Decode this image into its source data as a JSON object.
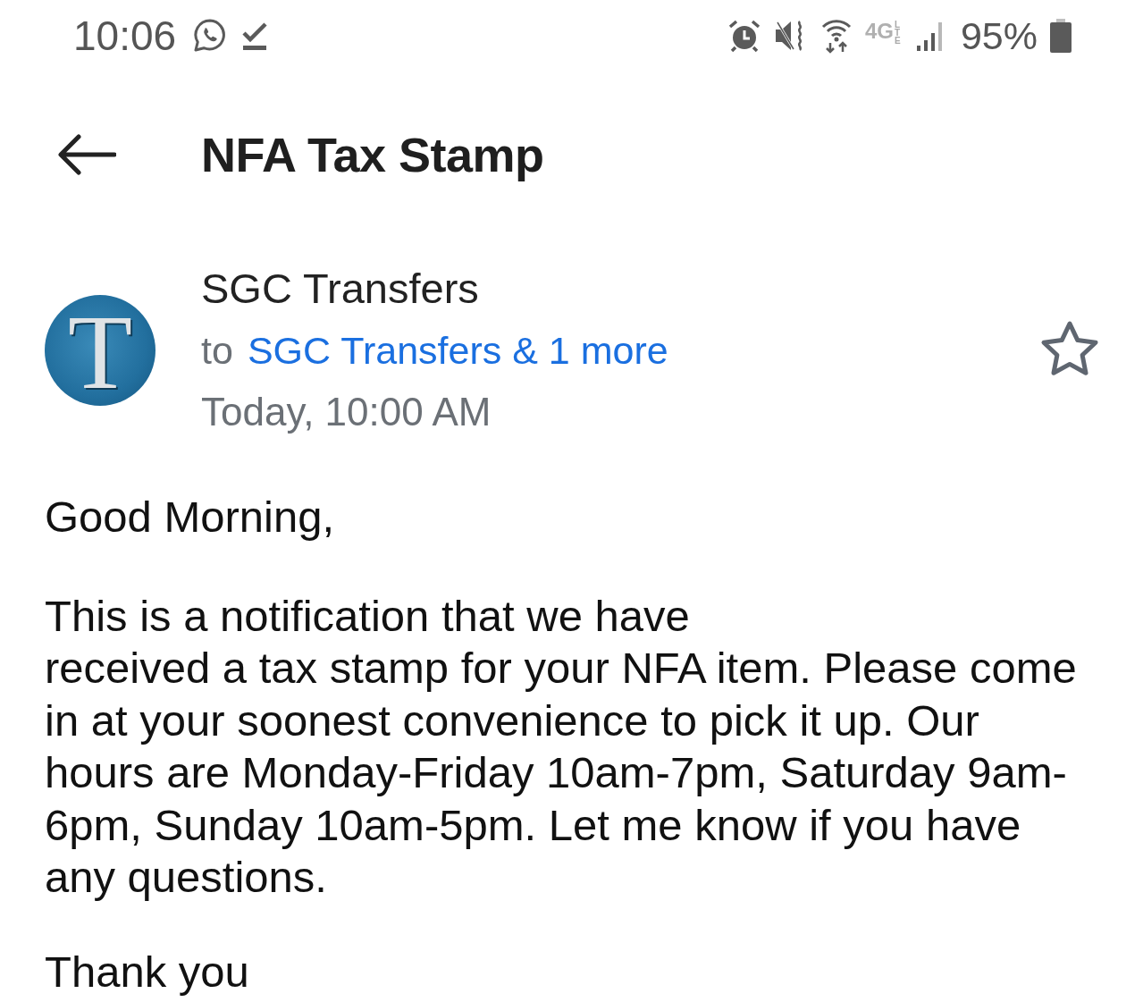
{
  "status_bar": {
    "time": "10:06",
    "network": "4G",
    "network_sub": "LTE",
    "battery": "95%"
  },
  "header": {
    "title": "NFA Tax Stamp"
  },
  "message": {
    "avatar_letter": "T",
    "sender": "SGC Transfers",
    "to_label": "to",
    "recipients": "SGC Transfers & 1 more",
    "date": "Today, 10:00 AM",
    "starred": false
  },
  "body": {
    "greeting": "Good Morning,",
    "paragraph": "This is a notification that we have\nreceived a tax stamp for your NFA item. Please come in at your soonest convenience to pick it up. Our hours are Monday-Friday 10am-7pm, Saturday 9am-6pm, Sunday 10am-5pm. Let me know if you have any questions.",
    "closing": "Thank you"
  }
}
